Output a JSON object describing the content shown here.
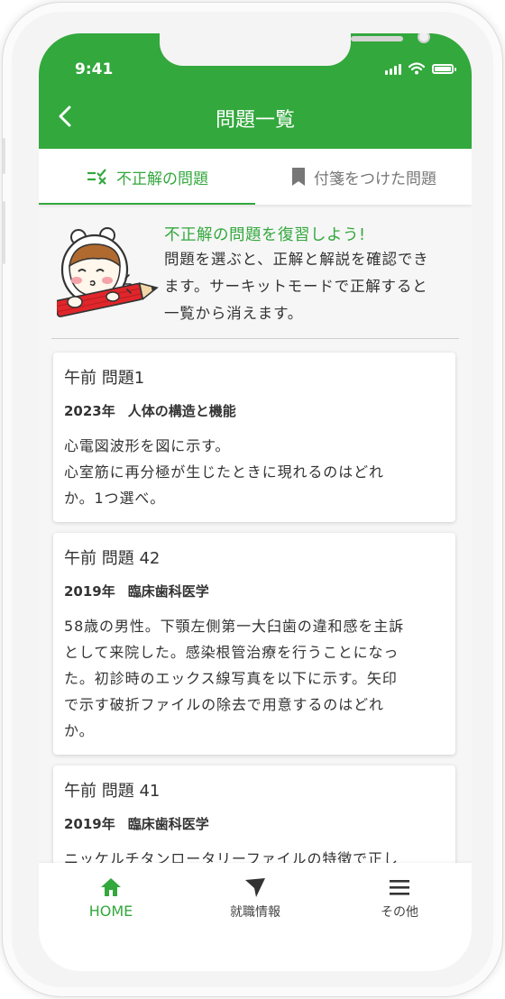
{
  "status_bar": {
    "time": "9:41"
  },
  "header": {
    "title": "問題一覧",
    "back_icon": "chevron-left-icon"
  },
  "tabs": [
    {
      "label": "不正解の問題",
      "icon": "incorrect-list-icon",
      "active": true
    },
    {
      "label": "付箋をつけた問題",
      "icon": "bookmark-icon",
      "active": false
    }
  ],
  "intro": {
    "title": "不正解の問題を復習しよう!",
    "lines": [
      "問題を選ぶと、正解と解説を確認でき",
      "ます。サーキットモードで正解すると",
      "一覧から消えます。"
    ]
  },
  "questions": [
    {
      "title": "午前 問題1",
      "year": "2023年",
      "subject": "人体の構造と機能",
      "lines": [
        "心電図波形を図に示す。",
        "心室筋に再分極が生じたときに現れるのはどれ",
        "か。1つ選べ。"
      ]
    },
    {
      "title": "午前 問題 42",
      "year": "2019年",
      "subject": "臨床歯科医学",
      "lines": [
        "58歳の男性。下顎左側第一大臼歯の違和感を主訴",
        "として来院した。感染根管治療を行うことになっ",
        "た。初診時のエックス線写真を以下に示す。矢印",
        "で示す破折ファイルの除去で用意するのはどれ",
        "か。"
      ]
    },
    {
      "title": "午前 問題 41",
      "year": "2019年",
      "subject": "臨床歯科医学",
      "lines": [
        "ニッケルチタンロータリーファイルの特徴で正し"
      ]
    }
  ],
  "bottom_nav": [
    {
      "label": "HOME",
      "icon": "home-icon",
      "active": true
    },
    {
      "label": "就職情報",
      "icon": "send-arrow-icon",
      "active": false
    },
    {
      "label": "その他",
      "icon": "menu-icon",
      "active": false
    }
  ],
  "colors": {
    "accent": "#33a83d",
    "background": "#f6f6f6",
    "text": "#333333"
  }
}
